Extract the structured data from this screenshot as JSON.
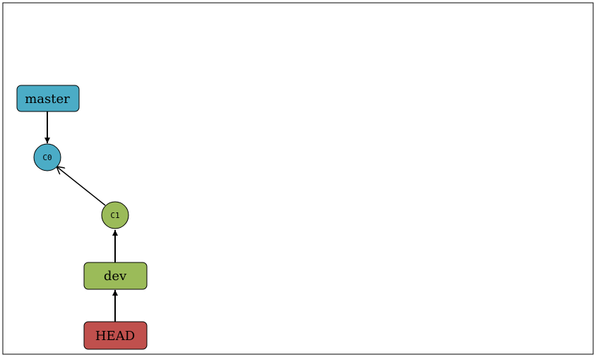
{
  "diagram": {
    "nodes": {
      "master": {
        "label": "master",
        "color": "#4bacc6"
      },
      "c0": {
        "label": "C0",
        "color": "#4bacc6"
      },
      "c1": {
        "label": "C1",
        "color": "#9bbb59"
      },
      "dev": {
        "label": "dev",
        "color": "#9bbb59"
      },
      "head": {
        "label": "HEAD",
        "color": "#c0504d"
      }
    },
    "edges": [
      {
        "from": "master",
        "to": "c0"
      },
      {
        "from": "c1",
        "to": "c0"
      },
      {
        "from": "dev",
        "to": "c1"
      },
      {
        "from": "head",
        "to": "dev"
      }
    ]
  }
}
